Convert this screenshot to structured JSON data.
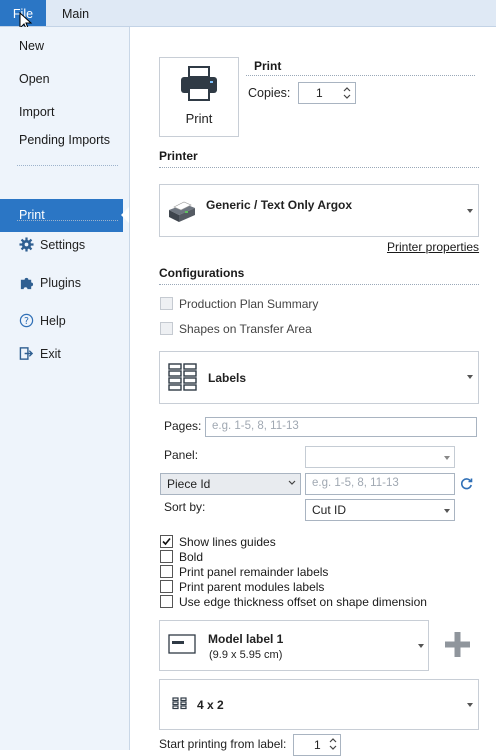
{
  "ribbon": {
    "tabs": [
      {
        "label": "File"
      },
      {
        "label": "Main"
      }
    ]
  },
  "sidebar": {
    "items": [
      {
        "label": "New"
      },
      {
        "label": "Open"
      },
      {
        "label": "Import"
      },
      {
        "label": "Pending Imports"
      },
      {
        "label": "Print"
      },
      {
        "label": "Settings",
        "icon": "gear-icon"
      },
      {
        "label": "Plugins",
        "icon": "puzzle-icon"
      },
      {
        "label": "Help",
        "icon": "help-icon"
      },
      {
        "label": "Exit",
        "icon": "exit-icon"
      }
    ],
    "selected": "Print"
  },
  "print": {
    "button_label": "Print",
    "section_title": "Print",
    "copies_label": "Copies:",
    "copies_value": "1"
  },
  "printer": {
    "section_title": "Printer",
    "selected": "Generic / Text Only Argox",
    "properties_link": "Printer properties"
  },
  "configurations": {
    "section_title": "Configurations",
    "options": [
      {
        "label": "Production Plan Summary",
        "checked": false,
        "enabled": false
      },
      {
        "label": "Shapes on Transfer Area",
        "checked": false,
        "enabled": false
      }
    ],
    "type_selected": "Labels"
  },
  "labels": {
    "pages_label": "Pages:",
    "pages_placeholder": "e.g. 1-5, 8, 11-13",
    "panel_label": "Panel:",
    "panel_value": "",
    "filter_field": "Piece Id",
    "filter_placeholder": "e.g. 1-5, 8, 11-13",
    "sort_label": "Sort by:",
    "sort_value": "Cut ID",
    "checkboxes": [
      {
        "label": "Show lines guides",
        "checked": true
      },
      {
        "label": "Bold",
        "checked": false
      },
      {
        "label": "Print panel remainder labels",
        "checked": false
      },
      {
        "label": "Print parent modules labels",
        "checked": false
      },
      {
        "label": "Use edge thickness offset on shape dimension",
        "checked": false
      }
    ],
    "model_name": "Model label 1",
    "model_size": "(9.9 x 5.95 cm)",
    "layout": "4 x 2",
    "start_label": "Start printing from label:",
    "start_value": "1"
  },
  "colors": {
    "accent": "#2b76c5",
    "sidebar_bg": "#eef4fb",
    "ribbon_bg": "#dfe9f5"
  }
}
